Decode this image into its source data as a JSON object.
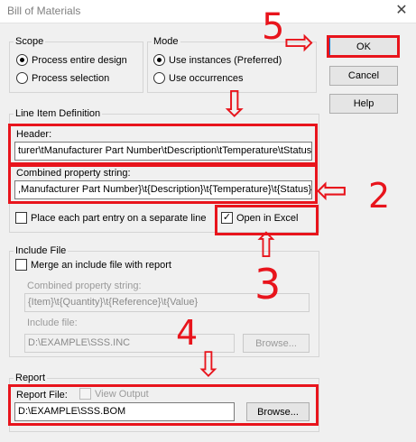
{
  "window": {
    "title": "Bill of Materials",
    "close_glyph": "✕"
  },
  "scope": {
    "legend": "Scope",
    "options": [
      "Process entire design",
      "Process selection"
    ],
    "selected": "Process entire design"
  },
  "mode": {
    "legend": "Mode",
    "options": [
      "Use instances (Preferred)",
      "Use occurrences"
    ],
    "selected": "Use instances (Preferred)"
  },
  "buttons": {
    "ok": "OK",
    "cancel": "Cancel",
    "help": "Help"
  },
  "line_item": {
    "legend": "Line Item Definition",
    "header_label": "Header:",
    "header_value": "turer\\tManufacturer Part Number\\tDescription\\tTemperature\\tStatus",
    "combined_label": "Combined property string:",
    "combined_value": ",Manufacturer Part Number}\\t{Description}\\t{Temperature}\\t{Status}",
    "separate_line_label": "Place each part entry on a separate line",
    "separate_line_checked": false,
    "open_excel_label": "Open in Excel",
    "open_excel_checked": true,
    "check_glyph": "✓"
  },
  "include_file": {
    "legend": "Include File",
    "merge_label": "Merge an include file with report",
    "merge_checked": false,
    "combined_label": "Combined property string:",
    "combined_value": "{Item}\\t{Quantity}\\t{Reference}\\t{Value}",
    "file_label": "Include file:",
    "file_value": "D:\\EXAMPLE\\SSS.INC",
    "browse_label": "Browse..."
  },
  "report": {
    "legend": "Report",
    "file_label": "Report File:",
    "view_output_label": "View Output",
    "view_output_checked": false,
    "file_value": "D:\\EXAMPLE\\SSS.BOM",
    "browse_label": "Browse..."
  },
  "annotations": {
    "color": "#e8141c",
    "numbers": [
      "5",
      "2",
      "3",
      "4"
    ],
    "arrow_glyph_down": "⇩",
    "arrow_glyph_up": "⇧",
    "arrow_glyph_right": "⇨",
    "arrow_glyph_left": "⇦"
  }
}
